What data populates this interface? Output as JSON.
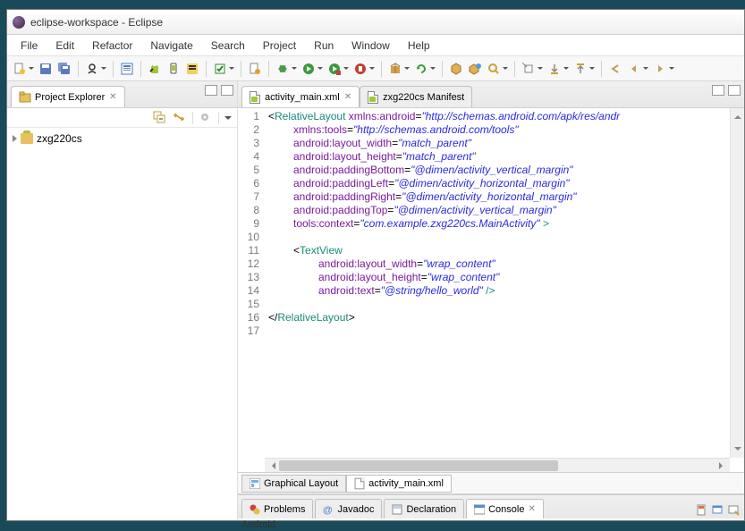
{
  "window": {
    "title": "eclipse-workspace - Eclipse"
  },
  "menu": {
    "items": [
      "File",
      "Edit",
      "Refactor",
      "Navigate",
      "Search",
      "Project",
      "Run",
      "Window",
      "Help"
    ]
  },
  "project_explorer": {
    "title": "Project Explorer",
    "items": [
      {
        "label": "zxg220cs"
      }
    ]
  },
  "editor": {
    "tabs": [
      {
        "label": "activity_main.xml",
        "active": true
      },
      {
        "label": "zxg220cs Manifest",
        "active": false
      }
    ],
    "lines": 17,
    "code_tokens": [
      [
        {
          "t": "punct",
          "v": "<"
        },
        {
          "t": "tag",
          "v": "RelativeLayout"
        },
        {
          "t": "plain",
          "v": " "
        },
        {
          "t": "attr",
          "v": "xmlns:android"
        },
        {
          "t": "punct",
          "v": "="
        },
        {
          "t": "str",
          "v": "\"http://schemas.android.com/apk/res/andr"
        }
      ],
      [
        {
          "t": "indent",
          "v": 4
        },
        {
          "t": "attr",
          "v": "xmlns:tools"
        },
        {
          "t": "punct",
          "v": "="
        },
        {
          "t": "str",
          "v": "\"http://schemas.android.com/tools\""
        }
      ],
      [
        {
          "t": "indent",
          "v": 4
        },
        {
          "t": "attr",
          "v": "android:layout_width"
        },
        {
          "t": "punct",
          "v": "="
        },
        {
          "t": "str",
          "v": "\"match_parent\""
        }
      ],
      [
        {
          "t": "indent",
          "v": 4
        },
        {
          "t": "attr",
          "v": "android:layout_height"
        },
        {
          "t": "punct",
          "v": "="
        },
        {
          "t": "str",
          "v": "\"match_parent\""
        }
      ],
      [
        {
          "t": "indent",
          "v": 4
        },
        {
          "t": "attr",
          "v": "android:paddingBottom"
        },
        {
          "t": "punct",
          "v": "="
        },
        {
          "t": "str",
          "v": "\"@dimen/activity_vertical_margin\""
        }
      ],
      [
        {
          "t": "indent",
          "v": 4
        },
        {
          "t": "attr",
          "v": "android:paddingLeft"
        },
        {
          "t": "punct",
          "v": "="
        },
        {
          "t": "str",
          "v": "\"@dimen/activity_horizontal_margin\""
        }
      ],
      [
        {
          "t": "indent",
          "v": 4
        },
        {
          "t": "attr",
          "v": "android:paddingRight"
        },
        {
          "t": "punct",
          "v": "="
        },
        {
          "t": "str",
          "v": "\"@dimen/activity_horizontal_margin\""
        }
      ],
      [
        {
          "t": "indent",
          "v": 4
        },
        {
          "t": "attr",
          "v": "android:paddingTop"
        },
        {
          "t": "punct",
          "v": "="
        },
        {
          "t": "str",
          "v": "\"@dimen/activity_vertical_margin\""
        }
      ],
      [
        {
          "t": "indent",
          "v": 4
        },
        {
          "t": "attr",
          "v": "tools:context"
        },
        {
          "t": "punct",
          "v": "="
        },
        {
          "t": "str",
          "v": "\"com.example.zxg220cs.MainActivity\""
        },
        {
          "t": "plain",
          "v": " "
        },
        {
          "t": "tag",
          "v": ">"
        }
      ],
      [],
      [
        {
          "t": "indent",
          "v": 4
        },
        {
          "t": "punct",
          "v": "<"
        },
        {
          "t": "tag",
          "v": "TextView"
        }
      ],
      [
        {
          "t": "indent",
          "v": 8
        },
        {
          "t": "attr",
          "v": "android:layout_width"
        },
        {
          "t": "punct",
          "v": "="
        },
        {
          "t": "str",
          "v": "\"wrap_content\""
        }
      ],
      [
        {
          "t": "indent",
          "v": 8
        },
        {
          "t": "attr",
          "v": "android:layout_height"
        },
        {
          "t": "punct",
          "v": "="
        },
        {
          "t": "str",
          "v": "\"wrap_content\""
        }
      ],
      [
        {
          "t": "indent",
          "v": 8
        },
        {
          "t": "attr",
          "v": "android:text"
        },
        {
          "t": "punct",
          "v": "="
        },
        {
          "t": "str",
          "v": "\"@string/hello_world\""
        },
        {
          "t": "plain",
          "v": " "
        },
        {
          "t": "tag",
          "v": "/>"
        }
      ],
      [],
      [
        {
          "t": "punct",
          "v": "</"
        },
        {
          "t": "tag",
          "v": "RelativeLayout"
        },
        {
          "t": "punct",
          "v": ">"
        }
      ],
      []
    ],
    "bottom_tabs": [
      {
        "label": "Graphical Layout",
        "active": false
      },
      {
        "label": "activity_main.xml",
        "active": true
      }
    ]
  },
  "bottom_views": {
    "tabs": [
      {
        "icon": "problems-icon",
        "label": "Problems"
      },
      {
        "icon": "javadoc-icon",
        "label": "Javadoc"
      },
      {
        "icon": "declaration-icon",
        "label": "Declaration"
      },
      {
        "icon": "console-icon",
        "label": "Console",
        "active": true
      }
    ],
    "content_line": "Android"
  }
}
